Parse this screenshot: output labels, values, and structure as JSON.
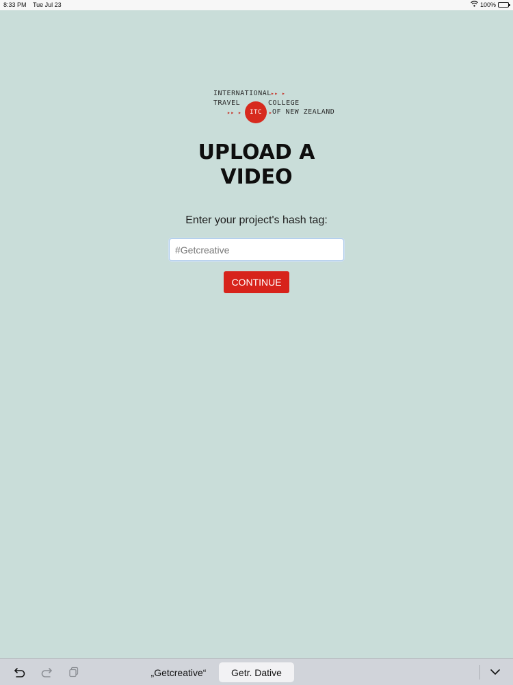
{
  "status_bar": {
    "time": "8:33 PM",
    "date": "Tue Jul 23",
    "battery": "100%"
  },
  "logo": {
    "line1": "INTERNATIONAL",
    "line2a": "TRAVEL",
    "line2b": "COLLEGE",
    "line3": "OF NEW ZEALAND",
    "seal": "ITC"
  },
  "main": {
    "title_line1": "UPLOAD A",
    "title_line2": "VIDEO",
    "prompt": "Enter your project's hash tag:",
    "input_value": "#Getcreative",
    "continue_label": "CONTINUE",
    "accent_color": "#d7231b"
  },
  "keyboard_bar": {
    "suggestion_1": "„Getcreative“",
    "suggestion_2": "Getr. Dative",
    "icons": [
      "undo-icon",
      "redo-icon",
      "paste-icon",
      "dismiss-keyboard-icon"
    ]
  }
}
